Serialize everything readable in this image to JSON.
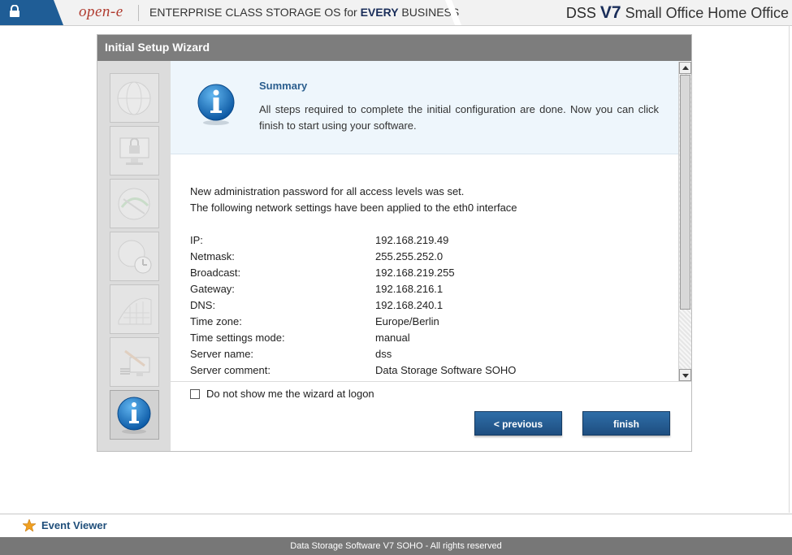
{
  "header": {
    "logo_text": "open-e",
    "tagline_pre": "ENTERPRISE CLASS STORAGE OS for ",
    "tagline_bold": "EVERY",
    "tagline_post": " BUSINESS",
    "product_pre": "DSS ",
    "product_version": "V7",
    "product_edition": " Small Office Home Office"
  },
  "wizard": {
    "title": "Initial Setup Wizard",
    "summary_title": "Summary",
    "summary_text": "All steps required to complete the initial configuration are done. Now you can click finish to start using your software.",
    "message_line1": "New administration password for all access levels was set.",
    "message_line2": "The following network settings have been applied to the eth0 interface",
    "settings": [
      {
        "label": "IP:",
        "value": "192.168.219.49"
      },
      {
        "label": "Netmask:",
        "value": "255.255.252.0"
      },
      {
        "label": "Broadcast:",
        "value": "192.168.219.255"
      },
      {
        "label": "Gateway:",
        "value": "192.168.216.1"
      },
      {
        "label": "DNS:",
        "value": "192.168.240.1"
      },
      {
        "label": "Time zone:",
        "value": "Europe/Berlin"
      },
      {
        "label": "Time settings mode:",
        "value": "manual"
      },
      {
        "label": "Server name:",
        "value": "dss"
      },
      {
        "label": "Server comment:",
        "value": "Data Storage Software SOHO"
      }
    ],
    "checkbox_label": "Do not show me the wizard at logon",
    "prev_label": "< previous",
    "finish_label": "finish",
    "steps": [
      "globe-icon",
      "monitor-lock-icon",
      "network-globe-icon",
      "clock-globe-icon",
      "grid-icon",
      "server-settings-icon",
      "info-icon"
    ]
  },
  "bottom": {
    "event_viewer_label": "Event Viewer",
    "footer_text": "Data Storage Software V7 SOHO - All rights reserved"
  },
  "colors": {
    "accent_blue": "#1f5d96",
    "button_blue": "#2f6ea8",
    "title_gray": "#7d7d7d",
    "summary_bg": "#eef6fc",
    "logo_red": "#b03a2e"
  }
}
